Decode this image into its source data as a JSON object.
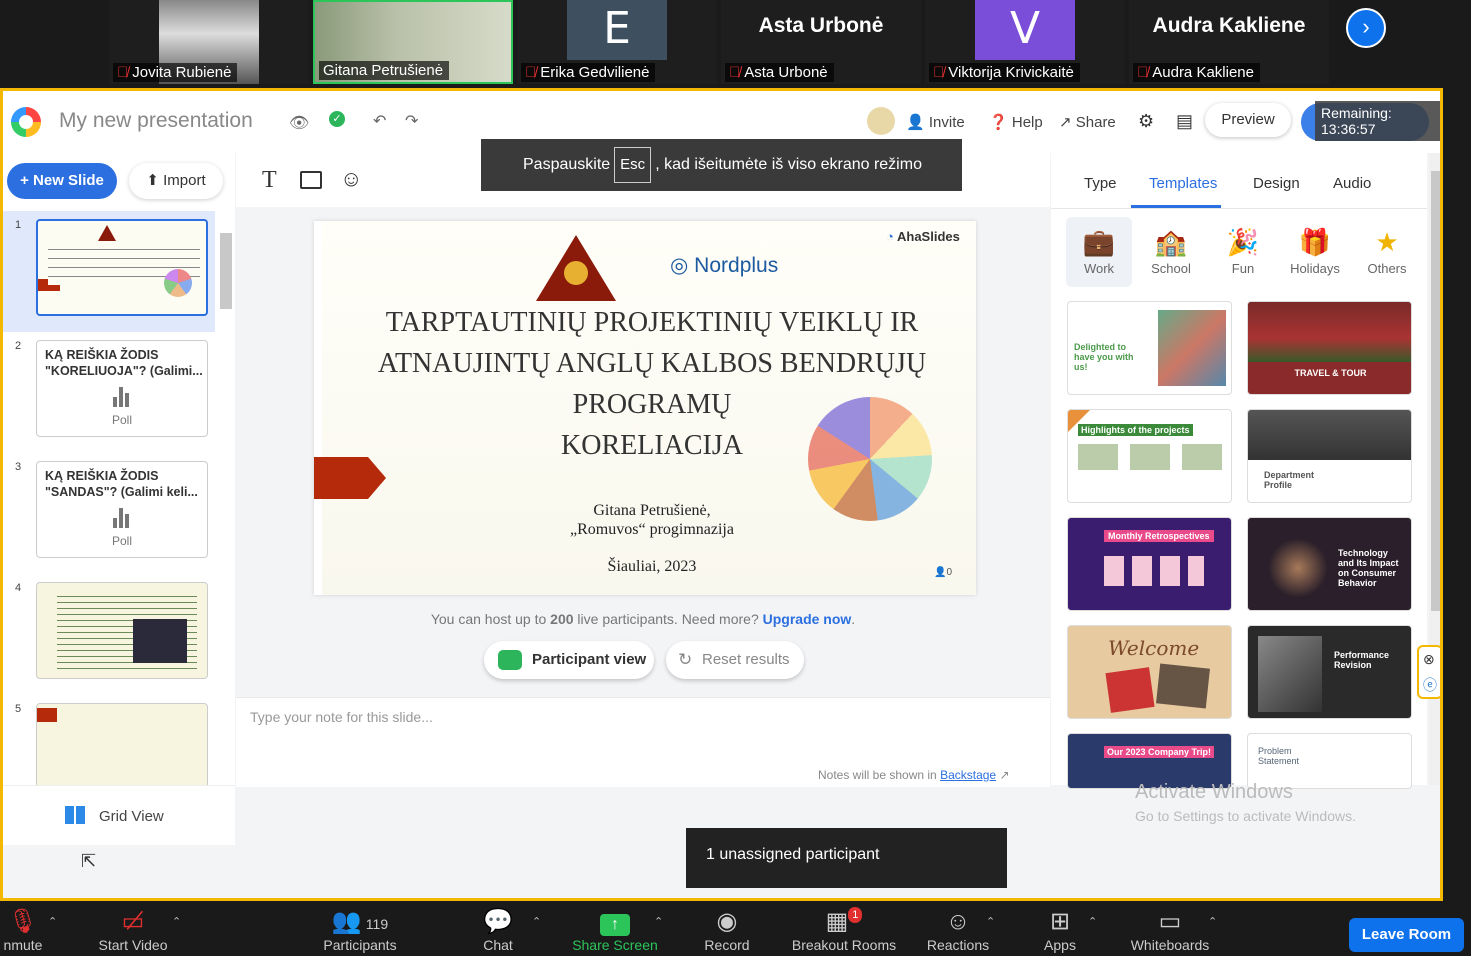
{
  "participants": [
    {
      "name": "Jovita Rubienė",
      "display": "photo",
      "big": ""
    },
    {
      "name": "Gitana Petrušienė",
      "display": "photo",
      "big": ""
    },
    {
      "name": "Erika Gedvilienė",
      "display": "letter",
      "big": "E"
    },
    {
      "name": "Asta Urbonė",
      "display": "name",
      "big": "Asta Urbonė"
    },
    {
      "name": "Viktorija Krivickaitė",
      "display": "letter",
      "big": "V"
    },
    {
      "name": "Audra Kakliene",
      "display": "name",
      "big": "Audra Kakliene"
    }
  ],
  "app": {
    "title": "My new presentation",
    "invite": "Invite",
    "help": "Help",
    "share": "Share",
    "preview": "Preview",
    "present": "Present",
    "remaining": "Remaining: 13:36:57"
  },
  "esc_banner": {
    "before": "Paspauskite",
    "key": "Esc",
    "after": ", kad išeitumėte iš viso ekrano režimo"
  },
  "left": {
    "new_slide": "+ New Slide",
    "import": "Import",
    "grid_view": "Grid View",
    "slides": [
      {
        "n": "1",
        "type": "cover"
      },
      {
        "n": "2",
        "title": "KĄ REIŠKIA ŽODIS \"KORELIUOJA\"? (Galimi...",
        "kind": "Poll"
      },
      {
        "n": "3",
        "title": "KĄ REIŠKIA ŽODIS \"SANDAS\"? (Galimi keli...",
        "kind": "Poll"
      },
      {
        "n": "4",
        "type": "content"
      },
      {
        "n": "5",
        "type": "content"
      }
    ]
  },
  "slide": {
    "brand": "AhaSlides",
    "partner": "Nordplus",
    "title_lines": [
      "TARPTAUTINIŲ PROJEKTINIŲ VEIKLŲ IR",
      "ATNAUJINTŲ ANGLŲ KALBOS BENDRŲJŲ",
      "PROGRAMŲ",
      "KORELIACIJA"
    ],
    "author": "Gitana Petrušienė,",
    "school": "„Romuvos“ progimnazija",
    "place": "Šiauliai, 2023",
    "count": "0"
  },
  "host_note": {
    "text": "You can host up to ",
    "num": "200",
    "rest": " live participants. Need more? ",
    "link": "Upgrade now",
    "end": "."
  },
  "participant_view": "Participant view",
  "reset_results": "Reset results",
  "notes": {
    "placeholder": "Type your note for this slide...",
    "hint": "Notes will be shown in ",
    "link": "Backstage"
  },
  "right": {
    "tabs": [
      "Type",
      "Templates",
      "Design",
      "Audio"
    ],
    "categories": [
      "Work",
      "School",
      "Fun",
      "Holidays",
      "Others"
    ],
    "templates": [
      {
        "t": "Delighted to have you with us!",
        "bg": "#ffffff",
        "fg": "#4a9a4a"
      },
      {
        "t": "TRAVEL & TOUR",
        "bg": "#8a2a2a",
        "fg": "#ffffff"
      },
      {
        "t": "Highlights of the projects",
        "bg": "#ffffff",
        "fg": "#3a7a3a"
      },
      {
        "t": "Department Profile",
        "bg": "#ffffff",
        "fg": "#555555"
      },
      {
        "t": "Monthly Retrospectives",
        "bg": "#3a1d6e",
        "fg": "#ffffff"
      },
      {
        "t": "Technology and Its Impact on Consumer Behavior",
        "bg": "#2a1f2a",
        "fg": "#ffffff"
      },
      {
        "t": "Welcome",
        "bg": "#e8caa0",
        "fg": "#7a4a2a"
      },
      {
        "t": "Performance Revision",
        "bg": "#2a2a2a",
        "fg": "#ffffff"
      },
      {
        "t": "Our 2023 Company Trip!",
        "bg": "#2a3a6a",
        "fg": "#ffffff"
      },
      {
        "t": "Problem Statement",
        "bg": "#ffffff",
        "fg": "#556677"
      }
    ]
  },
  "activate": {
    "title": "Activate Windows",
    "sub": "Go to Settings to activate Windows."
  },
  "toast": "1 unassigned participant",
  "toolbar": {
    "unmute": "nmute",
    "start_video": "Start Video",
    "participants": "Participants",
    "participants_count": "119",
    "chat": "Chat",
    "share_screen": "Share Screen",
    "record": "Record",
    "breakout": "Breakout Rooms",
    "breakout_badge": "1",
    "reactions": "Reactions",
    "apps": "Apps",
    "whiteboards": "Whiteboards",
    "leave": "Leave Room"
  },
  "colors": {
    "accent": "#2b6fe0",
    "zoom_blue": "#0e72ed",
    "share_border": "#f5b800",
    "share_green": "#19c37d"
  }
}
